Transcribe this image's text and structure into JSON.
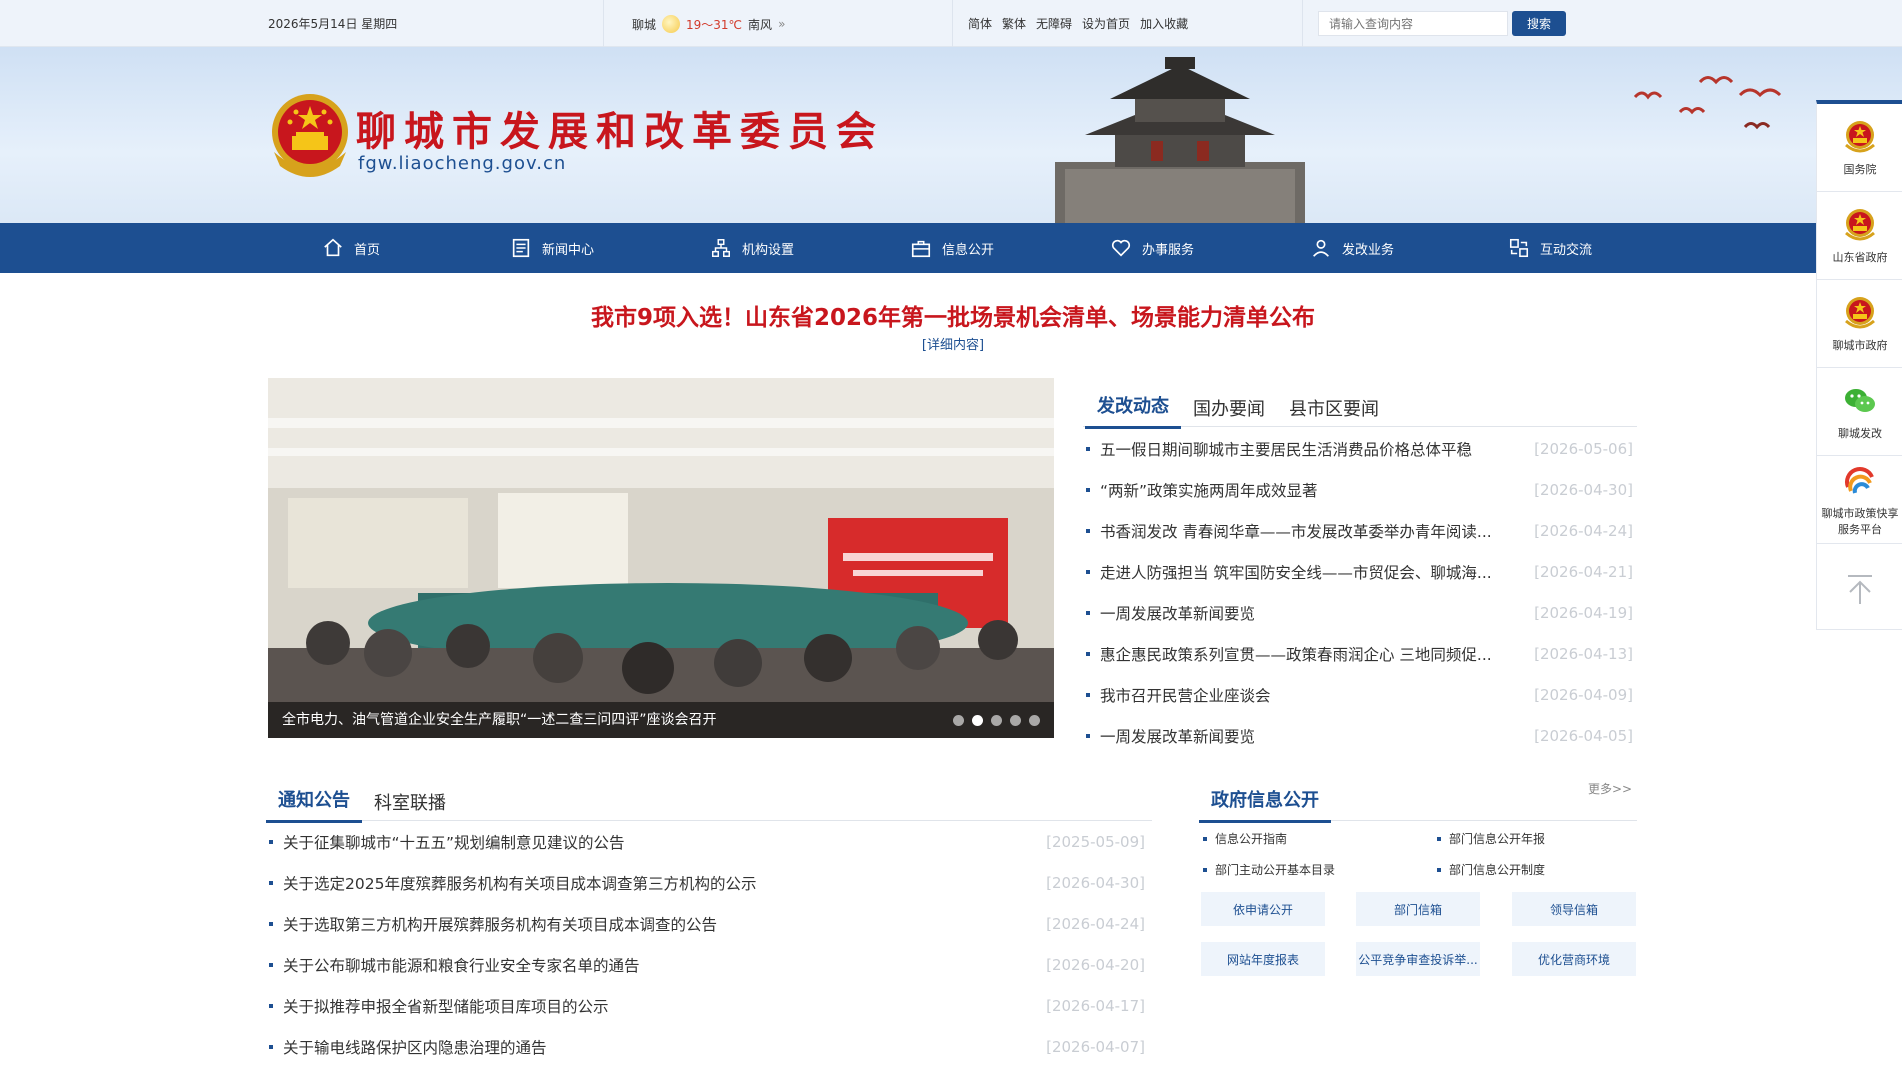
{
  "topbar": {
    "date": "2026年5月14日 星期四",
    "city": "聊城",
    "temperature": "19～31℃",
    "wind": "南风",
    "wind_arrow": "»",
    "links": [
      "简体",
      "繁体",
      "无障碍",
      "设为首页",
      "加入收藏"
    ],
    "search_placeholder": "请输入查询内容",
    "search_button": "搜索"
  },
  "header": {
    "title": "聊城市发展和改革委员会",
    "domain": "fgw.liaocheng.gov.cn"
  },
  "nav": {
    "items": [
      {
        "label": "首页",
        "icon": "home-icon"
      },
      {
        "label": "新闻中心",
        "icon": "news-icon"
      },
      {
        "label": "机构设置",
        "icon": "org-chart-icon"
      },
      {
        "label": "信息公开",
        "icon": "info-briefcase-icon"
      },
      {
        "label": "办事服务",
        "icon": "heart-icon"
      },
      {
        "label": "发改业务",
        "icon": "user-icon"
      },
      {
        "label": "互动交流",
        "icon": "exchange-icon"
      }
    ]
  },
  "headline": {
    "title": "我市9项入选！山东省2026年第一批场景机会清单、场景能力清单公布",
    "more": "[详细内容]"
  },
  "carousel": {
    "caption": "全市电力、油气管道企业安全生产履职“一述二查三问四评”座谈会召开",
    "slide_count": 5,
    "active_index": 1
  },
  "news_tabs": {
    "tabs": [
      "发改动态",
      "国办要闻",
      "县市区要闻"
    ],
    "active": 0,
    "items": [
      {
        "title": "五一假日期间聊城市主要居民生活消费品价格总体平稳",
        "date": "[2026-05-06]"
      },
      {
        "title": "“两新”政策实施两周年成效显著",
        "date": "[2026-04-30]"
      },
      {
        "title": "书香润发改 青春阅华章——市发展改革委举办青年阅读...",
        "date": "[2026-04-24]"
      },
      {
        "title": "走进人防强担当 筑牢国防安全线——市贸促会、聊城海...",
        "date": "[2026-04-21]"
      },
      {
        "title": "一周发展改革新闻要览",
        "date": "[2026-04-19]"
      },
      {
        "title": "惠企惠民政策系列宣贯——政策春雨润企心 三地同频促...",
        "date": "[2026-04-13]"
      },
      {
        "title": "我市召开民营企业座谈会",
        "date": "[2026-04-09]"
      },
      {
        "title": "一周发展改革新闻要览",
        "date": "[2026-04-05]"
      }
    ]
  },
  "notice_tabs": {
    "tabs": [
      "通知公告",
      "科室联播"
    ],
    "active": 0,
    "items": [
      {
        "title": "关于征集聊城市“十五五”规划编制意见建议的公告",
        "date": "[2025-05-09]"
      },
      {
        "title": "关于选定2025年度殡葬服务机构有关项目成本调查第三方机构的公示",
        "date": "[2026-04-30]"
      },
      {
        "title": "关于选取第三方机构开展殡葬服务机构有关项目成本调查的公告",
        "date": "[2026-04-24]"
      },
      {
        "title": "关于公布聊城市能源和粮食行业安全专家名单的通告",
        "date": "[2026-04-20]"
      },
      {
        "title": "关于拟推荐申报全省新型储能项目库项目的公示",
        "date": "[2026-04-17]"
      },
      {
        "title": "关于输电线路保护区内隐患治理的通告",
        "date": "[2026-04-07]"
      }
    ]
  },
  "gov_info": {
    "title": "政府信息公开",
    "more": "更多>>",
    "links": [
      "信息公开指南",
      "部门信息公开年报",
      "部门主动公开基本目录",
      "部门信息公开制度"
    ],
    "buttons": [
      "依申请公开",
      "部门信箱",
      "领导信箱",
      "网站年度报表",
      "公平竞争审查投诉举...",
      "优化营商环境"
    ]
  },
  "side_float": {
    "items": [
      {
        "label": "国务院",
        "icon": "national-emblem-icon"
      },
      {
        "label": "山东省政府",
        "icon": "national-emblem-icon"
      },
      {
        "label": "聊城市政府",
        "icon": "national-emblem-icon"
      },
      {
        "label": "聊城发改",
        "icon": "wechat-icon"
      },
      {
        "label": "聊城市政策快享服务平台",
        "icon": "policy-platform-logo-icon"
      }
    ],
    "back_to_top": "back-to-top-icon"
  },
  "colors": {
    "primary": "#1d4f91",
    "title_red": "#c8161d",
    "date_gray": "#c9cdd3",
    "topbar_bg": "#eef3fa"
  }
}
